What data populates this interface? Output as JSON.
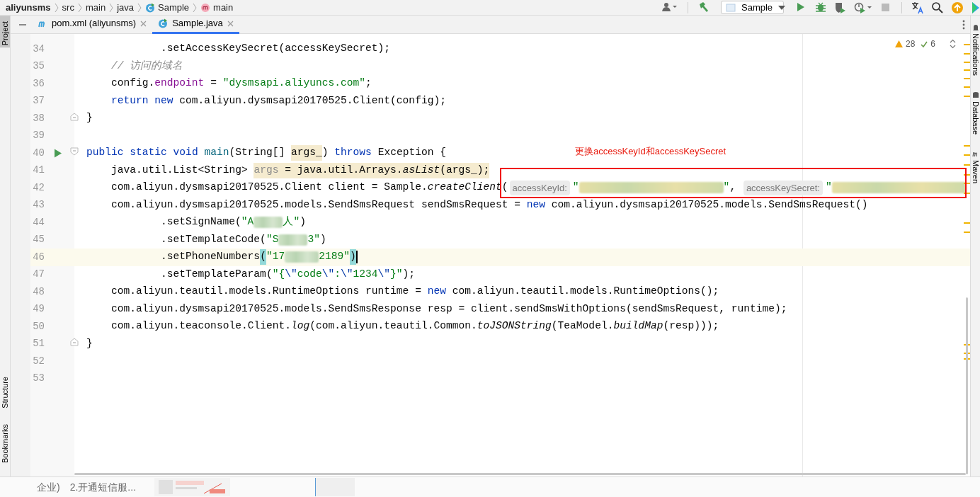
{
  "breadcrumbs": [
    {
      "label": "aliyunsms",
      "kind": "project"
    },
    {
      "label": "src",
      "kind": "folder"
    },
    {
      "label": "main",
      "kind": "folder"
    },
    {
      "label": "java",
      "kind": "folder"
    },
    {
      "label": "Sample",
      "kind": "class"
    },
    {
      "label": "main",
      "kind": "method"
    }
  ],
  "toolbar": {
    "run_config": "Sample",
    "buttons": [
      {
        "kind": "user"
      },
      {
        "kind": "build"
      },
      {
        "kind": "config"
      },
      {
        "kind": "run"
      },
      {
        "kind": "debug"
      },
      {
        "kind": "coverage"
      },
      {
        "kind": "profile"
      },
      {
        "kind": "stop",
        "disabled": true
      },
      {
        "kind": "translate"
      },
      {
        "kind": "search"
      },
      {
        "kind": "update"
      },
      {
        "kind": "plugin"
      }
    ]
  },
  "left_tool_windows": [
    {
      "label": "Project",
      "selected": true,
      "kind": "top"
    },
    {
      "label": "Structure",
      "selected": false,
      "kind": "bottom"
    },
    {
      "label": "Bookmarks",
      "selected": false,
      "kind": "bottom"
    }
  ],
  "right_tool_windows": [
    {
      "label": "Notifications"
    },
    {
      "label": "Database"
    },
    {
      "label": "Maven"
    }
  ],
  "tabs": [
    {
      "label": "pom.xml (aliyunsms)",
      "kind": "maven",
      "selected": false
    },
    {
      "label": "Sample.java",
      "kind": "class",
      "selected": true
    }
  ],
  "inspections": {
    "warnings": "28",
    "weak_warnings": "6"
  },
  "editor": {
    "lines": [
      {
        "number": "34",
        "kind": "chain",
        "tokens": [
          {
            "kind": "plain",
            "t": ".setAccessKeySecret(accessKeySecret);"
          }
        ]
      },
      {
        "number": "35",
        "kind": "statement",
        "tokens": [
          {
            "kind": "comment",
            "t": "// 访问的域名"
          }
        ]
      },
      {
        "number": "36",
        "kind": "statement",
        "tokens": [
          {
            "kind": "plain",
            "t": "config."
          },
          {
            "kind": "field",
            "t": "endpoint"
          },
          {
            "kind": "plain",
            "t": " = "
          },
          {
            "kind": "string",
            "t": "\"dysmsapi.aliyuncs.com\""
          },
          {
            "kind": "plain",
            "t": ";"
          }
        ]
      },
      {
        "number": "37",
        "kind": "statement",
        "tokens": [
          {
            "kind": "keyword",
            "t": "return new"
          },
          {
            "kind": "plain",
            "t": " com.aliyun.dysmsapi20170525.Client(config);"
          }
        ]
      },
      {
        "number": "38",
        "kind": "member",
        "fold_end": true,
        "tokens": [
          {
            "kind": "plain",
            "t": "}"
          }
        ]
      },
      {
        "number": "39"
      },
      {
        "number": "40",
        "kind": "member",
        "run_marker": true,
        "fold_start": true,
        "tokens": [
          {
            "kind": "keyword",
            "t": "public static void "
          },
          {
            "kind": "method",
            "t": "main"
          },
          {
            "kind": "plain",
            "t": "(String[] "
          },
          {
            "kind": "param",
            "t": "args_"
          },
          {
            "kind": "plain",
            "t": ") "
          },
          {
            "kind": "keyword",
            "t": "throws"
          },
          {
            "kind": "plain",
            "t": " Exception {"
          }
        ]
      },
      {
        "number": "41",
        "kind": "statement",
        "tokens": [
          {
            "kind": "plain",
            "t": "java.util.List<String> "
          },
          {
            "kind": "unused",
            "t": "args"
          },
          {
            "kind": "usage",
            "t": " = java.util.Arrays."
          },
          {
            "kind": "usage-italic",
            "t": "asList"
          },
          {
            "kind": "usage",
            "t": "(args_);"
          }
        ]
      },
      {
        "number": "42",
        "kind": "statement",
        "tokens": [
          {
            "kind": "plain",
            "t": "com.aliyun.dysmsapi20170525.Client client = Sample."
          },
          {
            "kind": "italic",
            "t": "createClient"
          },
          {
            "kind": "plain",
            "t": "("
          },
          {
            "kind": "hint",
            "t": "accessKeyId:"
          },
          {
            "kind": "string",
            "t": "\""
          },
          {
            "kind": "blur-long"
          },
          {
            "kind": "string",
            "t": "\""
          },
          {
            "kind": "plain",
            "t": ", "
          },
          {
            "kind": "hint",
            "t": "accessKeySecret:"
          },
          {
            "kind": "string",
            "t": "\""
          },
          {
            "kind": "blur-wide"
          }
        ]
      },
      {
        "number": "43",
        "kind": "statement",
        "tokens": [
          {
            "kind": "plain",
            "t": "com.aliyun.dysmsapi20170525.models.SendSmsRequest sendSmsRequest = "
          },
          {
            "kind": "keyword",
            "t": "new"
          },
          {
            "kind": "plain",
            "t": " com.aliyun.dysmsapi20170525.models.SendSmsRequest()"
          }
        ]
      },
      {
        "number": "44",
        "kind": "chain",
        "tokens": [
          {
            "kind": "plain",
            "t": ".setSignName("
          },
          {
            "kind": "string",
            "t": "\"A"
          },
          {
            "kind": "blur-short"
          },
          {
            "kind": "string",
            "t": "人\""
          },
          {
            "kind": "plain",
            "t": ")"
          }
        ]
      },
      {
        "number": "45",
        "kind": "chain",
        "tokens": [
          {
            "kind": "plain",
            "t": ".setTemplateCode("
          },
          {
            "kind": "string",
            "t": "\"S"
          },
          {
            "kind": "blur-short"
          },
          {
            "kind": "string",
            "t": "3\""
          },
          {
            "kind": "plain",
            "t": ")"
          }
        ]
      },
      {
        "number": "46",
        "kind": "chain",
        "current": true,
        "caret": true,
        "tokens": [
          {
            "kind": "plain",
            "t": ".setPhoneNumbers"
          },
          {
            "kind": "brace",
            "t": "("
          },
          {
            "kind": "string",
            "t": "\"17"
          },
          {
            "kind": "blur-medium"
          },
          {
            "kind": "string",
            "t": "2189\""
          },
          {
            "kind": "brace",
            "t": ")"
          }
        ]
      },
      {
        "number": "47",
        "kind": "chain",
        "tokens": [
          {
            "kind": "plain",
            "t": ".setTemplateParam("
          },
          {
            "kind": "string",
            "t": "\"{"
          },
          {
            "kind": "escape",
            "t": "\\\""
          },
          {
            "kind": "string",
            "t": "code"
          },
          {
            "kind": "escape",
            "t": "\\\""
          },
          {
            "kind": "string",
            "t": ":"
          },
          {
            "kind": "escape",
            "t": "\\\""
          },
          {
            "kind": "string",
            "t": "1234"
          },
          {
            "kind": "escape",
            "t": "\\\""
          },
          {
            "kind": "string",
            "t": "}\""
          },
          {
            "kind": "plain",
            "t": ");"
          }
        ]
      },
      {
        "number": "48",
        "kind": "statement",
        "tokens": [
          {
            "kind": "plain",
            "t": "com.aliyun.teautil.models.RuntimeOptions runtime = "
          },
          {
            "kind": "keyword",
            "t": "new"
          },
          {
            "kind": "plain",
            "t": " com.aliyun.teautil.models.RuntimeOptions();"
          }
        ]
      },
      {
        "number": "49",
        "kind": "statement",
        "tokens": [
          {
            "kind": "plain",
            "t": "com.aliyun.dysmsapi20170525.models.SendSmsResponse resp = client.sendSmsWithOptions(sendSmsRequest, runtime);"
          }
        ]
      },
      {
        "number": "50",
        "kind": "statement",
        "tokens": [
          {
            "kind": "plain",
            "t": "com.aliyun.teaconsole.Client."
          },
          {
            "kind": "italic",
            "t": "log"
          },
          {
            "kind": "plain",
            "t": "(com.aliyun.teautil.Common."
          },
          {
            "kind": "italic",
            "t": "toJSONString"
          },
          {
            "kind": "plain",
            "t": "(TeaModel."
          },
          {
            "kind": "italic",
            "t": "buildMap"
          },
          {
            "kind": "plain",
            "t": "(resp)));"
          }
        ]
      },
      {
        "number": "51",
        "kind": "member",
        "fold_end": true,
        "tokens": [
          {
            "kind": "plain",
            "t": "}"
          }
        ]
      },
      {
        "number": "52"
      },
      {
        "number": "53"
      }
    ]
  },
  "annotations": [
    {
      "kind": "note",
      "text": "更换accessKeyId和accessKeySecret"
    },
    {
      "kind": "box"
    }
  ],
  "background_window": {
    "texts": [
      "企业)",
      "2.开通短信服..."
    ]
  }
}
